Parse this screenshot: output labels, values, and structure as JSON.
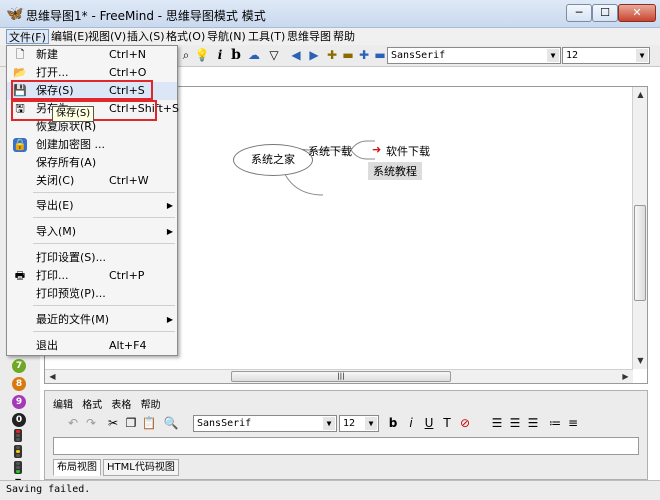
{
  "window": {
    "title": "思维导图1* - FreeMind - 思维导图模式 模式",
    "minimize": "─",
    "maximize": "☐",
    "close": "✕"
  },
  "menubar": [
    {
      "label": "文件(F)"
    },
    {
      "label": "编辑(E)"
    },
    {
      "label": "视图(V)"
    },
    {
      "label": "插入(S)"
    },
    {
      "label": "格式(O)"
    },
    {
      "label": "导航(N)"
    },
    {
      "label": "工具(T)"
    },
    {
      "label": "思维导图"
    },
    {
      "label": "帮助"
    }
  ],
  "toolbar": {
    "font": "SansSerif",
    "size": "12"
  },
  "file_menu": {
    "items": [
      {
        "label": "新建",
        "shortcut": "Ctrl+N"
      },
      {
        "label": "打开...",
        "shortcut": "Ctrl+O"
      },
      {
        "label": "保存(S)",
        "shortcut": "Ctrl+S"
      },
      {
        "label": "另存为...",
        "shortcut": "Ctrl+Shift+S"
      },
      {
        "label": "恢复原状(R)",
        "shortcut": ""
      },
      {
        "label": "创建加密图 ...",
        "shortcut": ""
      },
      {
        "label": "保存所有(A)",
        "shortcut": ""
      },
      {
        "label": "关闭(C)",
        "shortcut": "Ctrl+W"
      },
      {
        "label": "导出(E)",
        "shortcut": ""
      },
      {
        "label": "导入(M)",
        "shortcut": ""
      },
      {
        "label": "打印设置(S)...",
        "shortcut": ""
      },
      {
        "label": "打印...",
        "shortcut": "Ctrl+P"
      },
      {
        "label": "打印预览(P)...",
        "shortcut": ""
      },
      {
        "label": "最近的文件(M)",
        "shortcut": ""
      },
      {
        "label": "退出",
        "shortcut": "Alt+F4"
      }
    ],
    "tooltip": "保存(S)"
  },
  "mindmap": {
    "root": "系统之家",
    "child": "系统下载",
    "grandchildren": [
      "软件下载",
      "系统教程"
    ],
    "link_arrow": "➜"
  },
  "editor": {
    "menu": [
      "编辑",
      "格式",
      "表格",
      "帮助"
    ],
    "font": "SansSerif",
    "size": "12",
    "tabs": [
      "布局视图",
      "HTML代码视图"
    ]
  },
  "status": "Saving failed.",
  "colors": {
    "highlight_box": "#e0282c",
    "link_arrow": "#d01818"
  }
}
